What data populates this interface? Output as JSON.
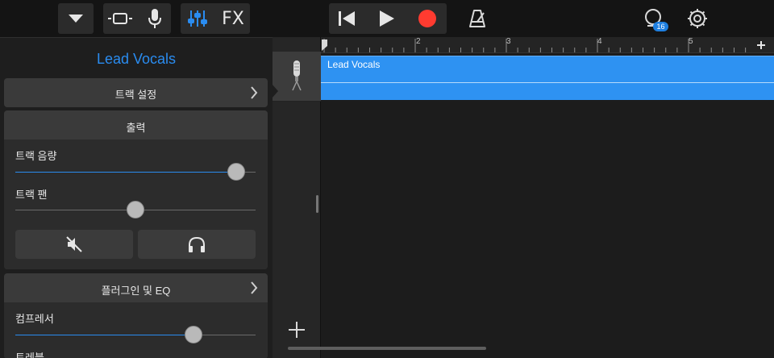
{
  "toolbar": {
    "fx_label": "FX",
    "loop_count": "16"
  },
  "inspector": {
    "title": "Lead Vocals",
    "track_settings_label": "트랙 설정",
    "output_label": "출력",
    "track_volume_label": "트랙 음량",
    "track_volume_value": 0.92,
    "track_pan_label": "트랙 팬",
    "track_pan_value": 0.5,
    "plugins_eq_label": "플러그인 및 EQ",
    "compressor_label": "컴프레서",
    "compressor_value": 0.74,
    "treble_label": "트레블"
  },
  "timeline": {
    "ruler_labels": [
      "2",
      "3",
      "4",
      "5"
    ],
    "region_label": "Lead Vocals"
  },
  "colors": {
    "accent": "#2a8cf0",
    "region": "#2e92f2",
    "record": "#ff3b30"
  },
  "icons": [
    "dropdown-icon",
    "tracks-view-icon",
    "microphone-icon",
    "mixer-icon",
    "rewind-icon",
    "play-icon",
    "record-icon",
    "metronome-icon",
    "loop-browser-icon",
    "settings-gear-icon",
    "mute-icon",
    "headphones-icon",
    "add-track-icon",
    "chevron-right-icon",
    "plus-icon"
  ]
}
